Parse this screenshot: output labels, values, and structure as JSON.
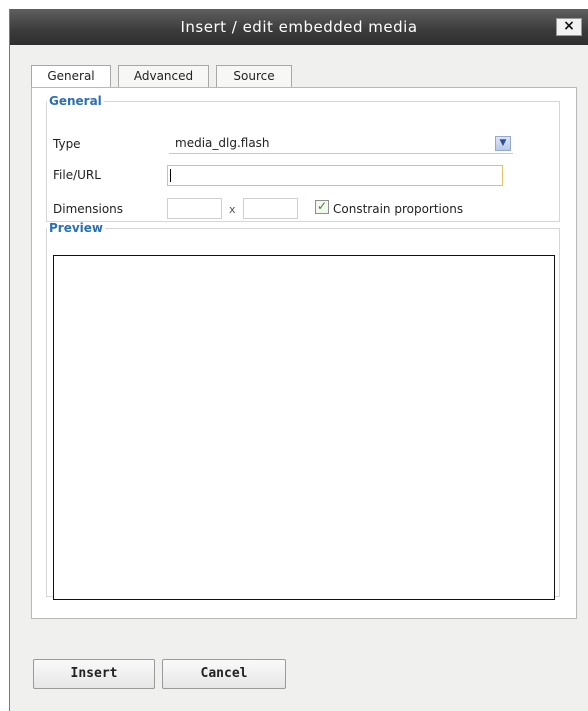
{
  "window": {
    "title": "Insert / edit embedded media",
    "close_label": "×"
  },
  "tabs": [
    {
      "label": "General",
      "active": true
    },
    {
      "label": "Advanced",
      "active": false
    },
    {
      "label": "Source",
      "active": false
    }
  ],
  "general": {
    "legend": "General",
    "type_label": "Type",
    "type_value": "media_dlg.flash",
    "file_url_label": "File/URL",
    "file_url_value": "",
    "dimensions_label": "Dimensions",
    "width_value": "",
    "height_value": "",
    "times_symbol": "x",
    "constrain_label": "Constrain proportions",
    "constrain_checked": true
  },
  "preview": {
    "legend": "Preview"
  },
  "buttons": {
    "insert_label": "Insert",
    "cancel_label": "Cancel"
  },
  "icons": {
    "close": "close-icon",
    "dropdown": "chevron-down-icon",
    "check": "checkmark-icon"
  },
  "colors": {
    "titlebar": "#3b3b3b",
    "legend": "#2b6fb6",
    "url_focus_border": "#e2c26a",
    "checkmark": "#2e8a2e"
  }
}
